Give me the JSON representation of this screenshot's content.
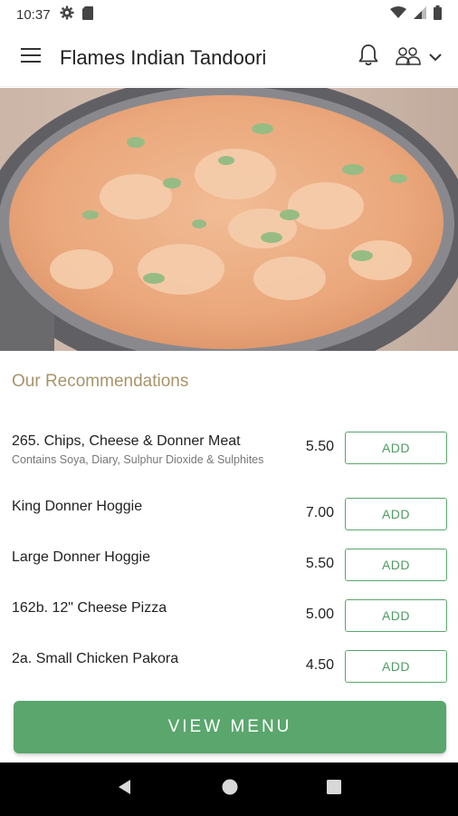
{
  "status_bar": {
    "time": "10:37"
  },
  "app_bar": {
    "title": "Flames Indian Tandoori"
  },
  "section": {
    "title": "Our Recommendations"
  },
  "recommendations": [
    {
      "name": "265. Chips, Cheese & Donner Meat",
      "description": "Contains Soya, Diary, Sulphur Dioxide & Sulphites",
      "price": "5.50",
      "add_label": "ADD"
    },
    {
      "name": "King Donner Hoggie",
      "description": "",
      "price": "7.00",
      "add_label": "ADD"
    },
    {
      "name": "Large Donner Hoggie",
      "description": "",
      "price": "5.50",
      "add_label": "ADD"
    },
    {
      "name": "162b. 12\" Cheese Pizza",
      "description": "",
      "price": "5.00",
      "add_label": "ADD"
    },
    {
      "name": "2a. Small Chicken Pakora",
      "description": "",
      "price": "4.50",
      "add_label": "ADD"
    }
  ],
  "view_menu": {
    "label": "VIEW MENU"
  },
  "colors": {
    "accent_green": "#5aa66d",
    "section_title": "#a8946a"
  },
  "icons": {
    "status_left": [
      "gear-icon",
      "sd-card-icon"
    ],
    "status_right": [
      "wifi-icon",
      "signal-icon",
      "battery-icon"
    ],
    "app_bar": [
      "menu-icon",
      "bell-icon",
      "profile-icon",
      "chevron-down-icon"
    ],
    "nav": [
      "back-icon",
      "home-icon",
      "recents-icon"
    ]
  }
}
